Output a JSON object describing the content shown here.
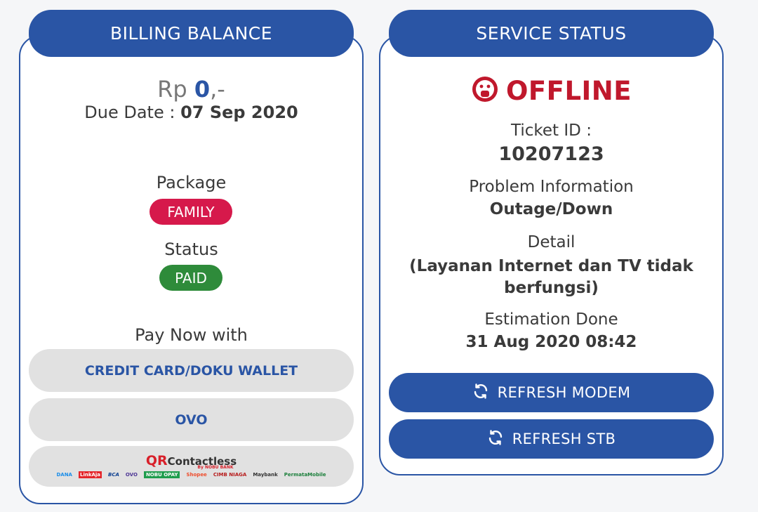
{
  "billing": {
    "header": "BILLING BALANCE",
    "currency": "Rp",
    "amount": "0",
    "amount_suffix": ",-",
    "due_label": "Due Date :",
    "due_date": "07 Sep 2020",
    "package_label": "Package",
    "package_value": "FAMILY",
    "status_label": "Status",
    "status_value": "PAID",
    "pay_label": "Pay Now with",
    "pay_options": [
      "CREDIT CARD/DOKU WALLET",
      "OVO"
    ],
    "qr": {
      "q": "QR",
      "title": "Contactless",
      "by": "By NOBU BANK",
      "logos": [
        "DANA",
        "LinkAja",
        "BCA",
        "OVO",
        "NOBU OPAY",
        "Shopee",
        "CIMB NIAGA",
        "Maybank",
        "PermataMobile"
      ]
    }
  },
  "service": {
    "header": "SERVICE STATUS",
    "status_text": "OFFLINE",
    "ticket_label": "Ticket ID :",
    "ticket_id": "10207123",
    "problem_label": "Problem Information",
    "problem_value": "Outage/Down",
    "detail_label": "Detail",
    "detail_value": "(Layanan Internet dan TV tidak berfungsi)",
    "estimation_label": "Estimation Done",
    "estimation_value": "31 Aug 2020 08:42",
    "refresh_modem": "REFRESH MODEM",
    "refresh_stb": "REFRESH STB"
  },
  "colors": {
    "primary": "#2a55a5",
    "offline": "#c0182c",
    "package_badge": "#d6194b",
    "paid_badge": "#2e8b3a",
    "pay_button": "#e1e1e1"
  },
  "icons": {
    "status": "sad-face-icon",
    "refresh": "refresh-icon"
  }
}
